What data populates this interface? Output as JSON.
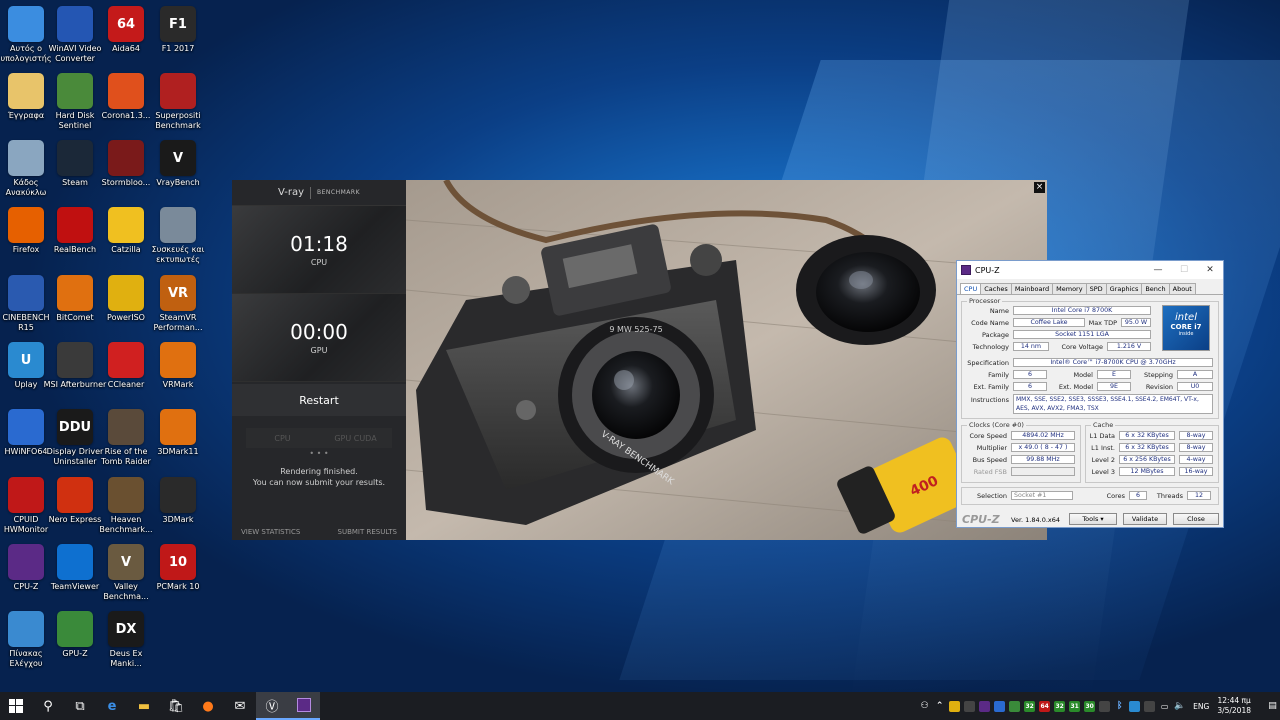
{
  "desktop": {
    "icons": [
      {
        "label": "Αυτός ο υπολογιστής",
        "icon": "this-pc-icon",
        "color": "#3b8de0"
      },
      {
        "label": "WinAVI Video Converter",
        "icon": "winavi-icon",
        "color": "#2456b3"
      },
      {
        "label": "Aida64",
        "icon": "aida64-icon",
        "color": "#c41a1a",
        "glyph": "64"
      },
      {
        "label": "F1 2017",
        "icon": "f1-2017-icon",
        "color": "#2a2a2a",
        "glyph": "F1"
      },
      {
        "label": "Έγγραφα",
        "icon": "documents-icon",
        "color": "#e8c46a"
      },
      {
        "label": "Hard Disk Sentinel",
        "icon": "hdsentinel-icon",
        "color": "#4a8a3a"
      },
      {
        "label": "Corona1.3...",
        "icon": "corona-icon",
        "color": "#e0501c"
      },
      {
        "label": "Superpositi Benchmark",
        "icon": "superposition-icon",
        "color": "#b02020"
      },
      {
        "label": "Κάδος Ανακύκλω",
        "icon": "recycle-bin-icon",
        "color": "#8aa6c0"
      },
      {
        "label": "Steam",
        "icon": "steam-icon",
        "color": "#1b2838"
      },
      {
        "label": "Stormbloo...",
        "icon": "stormblood-icon",
        "color": "#7a1a1a"
      },
      {
        "label": "VrayBench",
        "icon": "vraybench-icon",
        "color": "#1a1a1a",
        "glyph": "V"
      },
      {
        "label": "Firefox",
        "icon": "firefox-icon",
        "color": "#e66000"
      },
      {
        "label": "RealBench",
        "icon": "realbench-icon",
        "color": "#c01010"
      },
      {
        "label": "Catzilla",
        "icon": "catzilla-icon",
        "color": "#f0c020"
      },
      {
        "label": "Συσκευές και εκτυπωτές",
        "icon": "printers-icon",
        "color": "#7a8a9a"
      },
      {
        "label": "CINEBENCH R15",
        "icon": "cinebench-icon",
        "color": "#2a5ab0"
      },
      {
        "label": "BitComet",
        "icon": "bitcomet-icon",
        "color": "#e07010"
      },
      {
        "label": "PowerISO",
        "icon": "poweriso-icon",
        "color": "#e0b010"
      },
      {
        "label": "SteamVR Performan...",
        "icon": "steamvr-icon",
        "color": "#c06010",
        "glyph": "VR"
      },
      {
        "label": "Uplay",
        "icon": "uplay-icon",
        "color": "#2a8ad0",
        "glyph": "U"
      },
      {
        "label": "MSI Afterburner",
        "icon": "afterburner-icon",
        "color": "#3a3a3a"
      },
      {
        "label": "CCleaner",
        "icon": "ccleaner-icon",
        "color": "#d02020"
      },
      {
        "label": "VRMark",
        "icon": "vrmark-icon",
        "color": "#e07010"
      },
      {
        "label": "HWiNFO64",
        "icon": "hwinfo-icon",
        "color": "#2a6ad0"
      },
      {
        "label": "Display Driver Uninstaller",
        "icon": "ddu-icon",
        "color": "#1a1a1a",
        "glyph": "DDU"
      },
      {
        "label": "Rise of the Tomb Raider",
        "icon": "tombraider-icon",
        "color": "#5a4a3a"
      },
      {
        "label": "3DMark11",
        "icon": "3dmark11-icon",
        "color": "#e07010"
      },
      {
        "label": "CPUID HWMonitor",
        "icon": "hwmonitor-icon",
        "color": "#c01818"
      },
      {
        "label": "Nero Express",
        "icon": "nero-icon",
        "color": "#d03010"
      },
      {
        "label": "Heaven Benchmark...",
        "icon": "heaven-icon",
        "color": "#6a5030"
      },
      {
        "label": "3DMark",
        "icon": "3dmark-icon",
        "color": "#2a2a2a"
      },
      {
        "label": "CPU-Z",
        "icon": "cpuz-icon",
        "color": "#5b2a86"
      },
      {
        "label": "TeamViewer",
        "icon": "teamviewer-icon",
        "color": "#0e70d0"
      },
      {
        "label": "Valley Benchma...",
        "icon": "valley-icon",
        "color": "#6a5a40",
        "glyph": "V"
      },
      {
        "label": "PCMark 10",
        "icon": "pcmark10-icon",
        "color": "#c01818",
        "glyph": "10"
      },
      {
        "label": "Πίνακας Ελέγχου",
        "icon": "control-panel-icon",
        "color": "#3a8ad0"
      },
      {
        "label": "GPU-Z",
        "icon": "gpuz-icon",
        "color": "#3a8a3a"
      },
      {
        "label": "Deus Ex Manki...",
        "icon": "deusex-icon",
        "color": "#1a1a1a",
        "glyph": "DX"
      }
    ]
  },
  "vray": {
    "logo": "V-ray",
    "logo_sub": "BENCHMARK",
    "cpu_time": "01:18",
    "cpu_label": "CPU",
    "gpu_time": "00:00",
    "gpu_label": "GPU",
    "restart": "Restart",
    "tab_cpu": "CPU",
    "tab_gpu": "GPU CUDA",
    "dots": "• • •",
    "msg1": "Rendering finished.",
    "msg2": "You can now submit your results.",
    "view_stats": "VIEW STATISTICS",
    "submit": "SUBMIT RESULTS",
    "close": "×",
    "lens_text": "V-RAY BENCHMARK",
    "lens_ring": "9 MW 525-75",
    "film": "400"
  },
  "cpuz": {
    "title": "CPU-Z",
    "tabs": [
      "CPU",
      "Caches",
      "Mainboard",
      "Memory",
      "SPD",
      "Graphics",
      "Bench",
      "About"
    ],
    "processor_legend": "Processor",
    "name_label": "Name",
    "name": "Intel Core i7 8700K",
    "codename_label": "Code Name",
    "codename": "Coffee Lake",
    "maxtdp_label": "Max TDP",
    "maxtdp": "95.0 W",
    "package_label": "Package",
    "package": "Socket 1151 LGA",
    "tech_label": "Technology",
    "tech": "14 nm",
    "voltage_label": "Core Voltage",
    "voltage": "1.216 V",
    "spec_label": "Specification",
    "spec": "Intel® Core™ i7-8700K CPU @ 3.70GHz",
    "family_label": "Family",
    "family": "6",
    "model_label": "Model",
    "model": "E",
    "stepping_label": "Stepping",
    "stepping": "A",
    "extfamily_label": "Ext. Family",
    "extfamily": "6",
    "extmodel_label": "Ext. Model",
    "extmodel": "9E",
    "revision_label": "Revision",
    "revision": "U0",
    "instr_label": "Instructions",
    "instr1": "MMX, SSE, SSE2, SSE3, SSSE3, SSE4.1, SSE4.2, EM64T, VT-x,",
    "instr2": "AES, AVX, AVX2, FMA3, TSX",
    "intel_logo": "intel",
    "intel_sub": "CORE i7",
    "intel_inside": "inside",
    "clocks_legend": "Clocks (Core #0)",
    "corespeed_label": "Core Speed",
    "corespeed": "4894.02 MHz",
    "multiplier_label": "Multiplier",
    "multiplier": "x 49.0 ( 8 - 47 )",
    "busspeed_label": "Bus Speed",
    "busspeed": "99.88 MHz",
    "ratedfsb_label": "Rated FSB",
    "ratedfsb": "",
    "cache_legend": "Cache",
    "l1d_label": "L1 Data",
    "l1d": "6 x 32 KBytes",
    "l1d_way": "8-way",
    "l1i_label": "L1 Inst.",
    "l1i": "6 x 32 KBytes",
    "l1i_way": "8-way",
    "l2_label": "Level 2",
    "l2": "6 x 256 KBytes",
    "l2_way": "4-way",
    "l3_label": "Level 3",
    "l3": "12 MBytes",
    "l3_way": "16-way",
    "selection_label": "Selection",
    "selection": "Socket #1",
    "cores_label": "Cores",
    "cores": "6",
    "threads_label": "Threads",
    "threads": "12",
    "brand": "CPU-Z",
    "version": "Ver. 1.84.0.x64",
    "tools": "Tools",
    "validate": "Validate",
    "close": "Close",
    "minimize": "—",
    "maximize": "☐",
    "window_close": "✕"
  },
  "taskbar": {
    "lang": "ENG",
    "time": "12:44 πμ",
    "date": "3/5/2018"
  },
  "colors": {
    "accent": "#0078d7",
    "cpuz_value": "#203080",
    "vray_bg": "#1e1f21"
  }
}
